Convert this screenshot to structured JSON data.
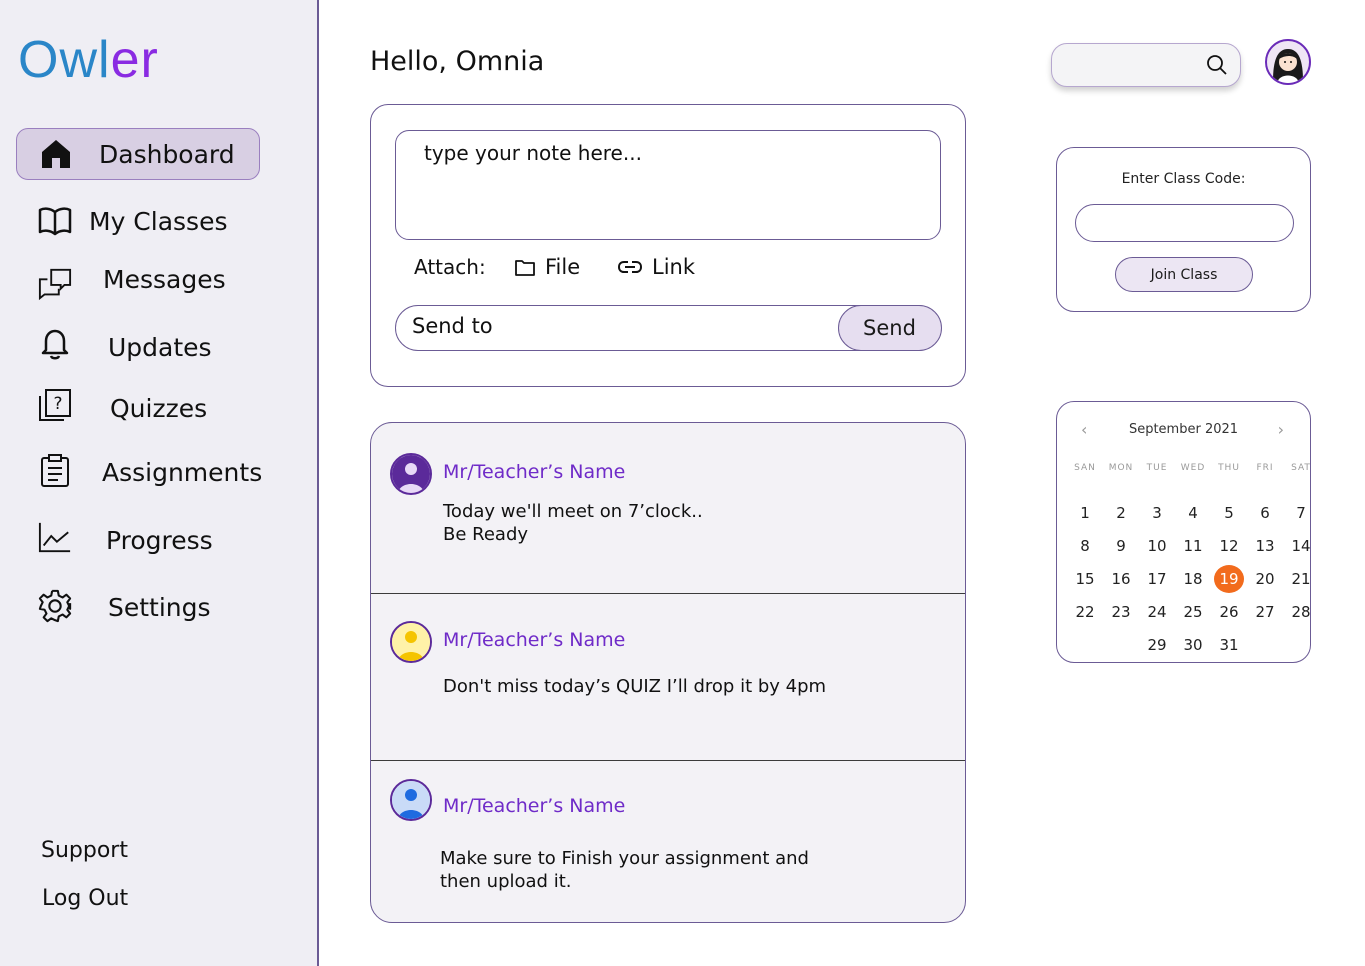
{
  "sidebar": {
    "logo": {
      "part1": "Owl",
      "part2": "er"
    },
    "items": [
      {
        "label": "Dashboard",
        "icon": "home-icon",
        "active": true
      },
      {
        "label": "My Classes",
        "icon": "book-icon"
      },
      {
        "label": "Messages",
        "icon": "chat-icon"
      },
      {
        "label": "Updates",
        "icon": "bell-icon"
      },
      {
        "label": "Quizzes",
        "icon": "quiz-icon"
      },
      {
        "label": "Assignments",
        "icon": "clipboard-icon"
      },
      {
        "label": "Progress",
        "icon": "chart-line-icon"
      },
      {
        "label": "Settings",
        "icon": "gear-icon"
      }
    ],
    "support": "Support",
    "logout": "Log Out"
  },
  "header": {
    "greeting": "Hello, Omnia",
    "search_placeholder": ""
  },
  "note": {
    "placeholder": "type your note here...",
    "attach_label": "Attach:",
    "file_label": "File",
    "link_label": "Link",
    "send_to_placeholder": "Send to",
    "send_label": "Send"
  },
  "feed": [
    {
      "name": "Mr/Teacher’s Name",
      "message": "Today we'll meet on 7’clock..\nBe Ready",
      "avatar_color": "#5b2a9a"
    },
    {
      "name": "Mr/Teacher’s Name",
      "message": "Don't miss today’s QUIZ I’ll drop it by 4pm",
      "avatar_color": "#f5c400"
    },
    {
      "name": "Mr/Teacher’s Name",
      "message": "Make sure to Finish your assignment and\nthen upload it.",
      "avatar_color": "#1e6be0"
    }
  ],
  "class_code": {
    "title": "Enter Class Code:",
    "join_label": "Join Class"
  },
  "calendar": {
    "month": "September 2021",
    "prev": "‹",
    "next": "›",
    "dow": [
      "SAN",
      "MON",
      "TUE",
      "WED",
      "THU",
      "FRI",
      "SAT"
    ],
    "weeks": [
      [
        "1",
        "2",
        "3",
        "4",
        "5",
        "6",
        "7"
      ],
      [
        "8",
        "9",
        "10",
        "11",
        "12",
        "13",
        "14"
      ],
      [
        "15",
        "16",
        "17",
        "18",
        "19",
        "20",
        "21"
      ],
      [
        "22",
        "23",
        "24",
        "25",
        "26",
        "27",
        "28"
      ],
      [
        "",
        "",
        "29",
        "30",
        "31",
        "",
        ""
      ]
    ],
    "today": "19"
  },
  "colors": {
    "accent": "#6b5b95",
    "brand_blue": "#2a86c8",
    "brand_purple": "#8a2be2",
    "teacher_name": "#6f2bc8",
    "today": "#f26b1d",
    "sidebar_bg": "#efeef4"
  }
}
